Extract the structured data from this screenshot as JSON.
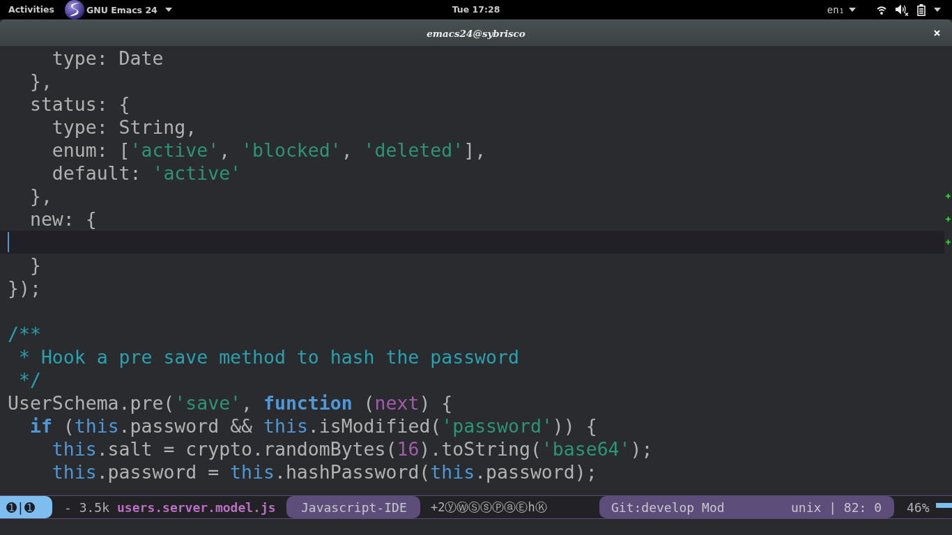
{
  "top_bar": {
    "activities": "Activities",
    "app_menu": "GNU Emacs 24",
    "clock": "Tue 17:28",
    "input_source": "en₁"
  },
  "window": {
    "title": "emacs24@sybrisco"
  },
  "editor": {
    "lines": [
      {
        "tokens": [
          {
            "text": "    type: Date",
            "kind": "plain"
          }
        ],
        "current": false,
        "added": false
      },
      {
        "tokens": [
          {
            "text": "  },",
            "kind": "plain"
          }
        ],
        "current": false,
        "added": false
      },
      {
        "tokens": [
          {
            "text": "  status: {",
            "kind": "plain"
          }
        ],
        "current": false,
        "added": false
      },
      {
        "tokens": [
          {
            "text": "    type: String,",
            "kind": "plain"
          }
        ],
        "current": false,
        "added": false
      },
      {
        "tokens": [
          {
            "text": "    enum: [",
            "kind": "plain"
          },
          {
            "text": "'active'",
            "kind": "string"
          },
          {
            "text": ", ",
            "kind": "plain"
          },
          {
            "text": "'blocked'",
            "kind": "string"
          },
          {
            "text": ", ",
            "kind": "plain"
          },
          {
            "text": "'deleted'",
            "kind": "string"
          },
          {
            "text": "],",
            "kind": "plain"
          }
        ],
        "current": false,
        "added": false
      },
      {
        "tokens": [
          {
            "text": "    default: ",
            "kind": "plain"
          },
          {
            "text": "'active'",
            "kind": "string"
          }
        ],
        "current": false,
        "added": false
      },
      {
        "tokens": [
          {
            "text": "  },",
            "kind": "plain"
          }
        ],
        "current": false,
        "added": true
      },
      {
        "tokens": [
          {
            "text": "  new: {",
            "kind": "plain"
          }
        ],
        "current": false,
        "added": true
      },
      {
        "current": true,
        "added": true
      },
      {
        "tokens": [
          {
            "text": "  }",
            "kind": "plain"
          }
        ],
        "current": false,
        "added": false
      },
      {
        "tokens": [
          {
            "text": "});",
            "kind": "plain"
          }
        ],
        "current": false,
        "added": false
      },
      {
        "current": false,
        "added": false
      },
      {
        "tokens": [
          {
            "text": "/**",
            "kind": "comment"
          }
        ],
        "current": false,
        "added": false
      },
      {
        "tokens": [
          {
            "text": " * Hook a pre save method to hash the password",
            "kind": "comment"
          }
        ],
        "current": false,
        "added": false
      },
      {
        "tokens": [
          {
            "text": " */",
            "kind": "comment"
          }
        ],
        "current": false,
        "added": false
      },
      {
        "tokens": [
          {
            "text": "UserSchema.pre(",
            "kind": "plain"
          },
          {
            "text": "'save'",
            "kind": "string"
          },
          {
            "text": ", ",
            "kind": "plain"
          },
          {
            "text": "function",
            "kind": "keyword"
          },
          {
            "text": " (",
            "kind": "plain"
          },
          {
            "text": "next",
            "kind": "param"
          },
          {
            "text": ") {",
            "kind": "plain"
          }
        ],
        "current": false,
        "added": false
      },
      {
        "tokens": [
          {
            "text": "  if",
            "kind": "keyword"
          },
          {
            "text": " (",
            "kind": "plain"
          },
          {
            "text": "this",
            "kind": "builtin"
          },
          {
            "text": ".password && ",
            "kind": "plain"
          },
          {
            "text": "this",
            "kind": "builtin"
          },
          {
            "text": ".isModified(",
            "kind": "plain"
          },
          {
            "text": "'password'",
            "kind": "string"
          },
          {
            "text": ")) {",
            "kind": "plain"
          }
        ],
        "current": false,
        "added": false
      },
      {
        "tokens": [
          {
            "text": "    this",
            "kind": "builtin"
          },
          {
            "text": ".salt = crypto.randomBytes(",
            "kind": "plain"
          },
          {
            "text": "16",
            "kind": "number"
          },
          {
            "text": ").toString(",
            "kind": "plain"
          },
          {
            "text": "'base64'",
            "kind": "string"
          },
          {
            "text": ");",
            "kind": "plain"
          }
        ],
        "current": false,
        "added": false
      },
      {
        "tokens": [
          {
            "text": "    this",
            "kind": "builtin"
          },
          {
            "text": ".password = ",
            "kind": "plain"
          },
          {
            "text": "this",
            "kind": "builtin"
          },
          {
            "text": ".hashPassword(",
            "kind": "plain"
          },
          {
            "text": "this",
            "kind": "builtin"
          },
          {
            "text": ".password);",
            "kind": "plain"
          }
        ],
        "current": false,
        "added": false
      }
    ]
  },
  "mode_line": {
    "window_numbers": "➊|➊",
    "buffer_status": "- 3.5k",
    "buffer_name": "users.server.model.js",
    "major_mode": "Javascript-IDE",
    "minor_modes": "+2ⓨⓌⓈⓢⓅⓐⒺhⓀ",
    "version_control": "Git:develop Mod",
    "position_info": "unix | 82: 0",
    "scroll_percent": "46%"
  }
}
